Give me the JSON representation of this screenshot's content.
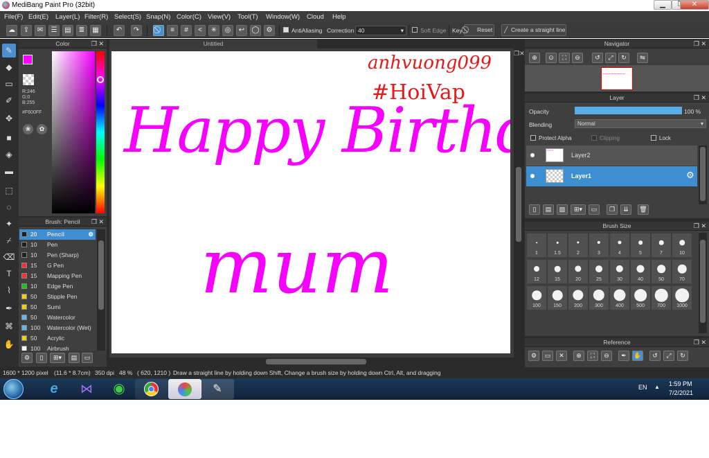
{
  "window": {
    "title": "MediBang Paint Pro (32bit)",
    "min": "▁",
    "max": "❐",
    "close": "✕"
  },
  "menu": [
    "File(F)",
    "Edit(E)",
    "Layer(L)",
    "Filter(R)",
    "Select(S)",
    "Snap(N)",
    "Color(C)",
    "View(V)",
    "Tool(T)",
    "Window(W)",
    "Cloud",
    "Help"
  ],
  "toolbar": {
    "antialiasing": "AntiAliasing",
    "correction_label": "Correction",
    "correction_value": "40",
    "soft_edge": "Soft Edge",
    "key": "Key",
    "reset": "Reset",
    "straight_line": "Create a straight line"
  },
  "color_panel": {
    "title": "Color",
    "r": "R:246",
    "g": "G:0",
    "b": "B:255",
    "hex": "#F600FF",
    "current": "#F600FF"
  },
  "brush_panel": {
    "title": "Brush: Pencil",
    "items": [
      {
        "size": "20",
        "name": "Pencil",
        "color": "#1e1e1e",
        "selected": true
      },
      {
        "size": "10",
        "name": "Pen",
        "color": "#1e1e1e"
      },
      {
        "size": "10",
        "name": "Pen (Sharp)",
        "color": "#1e1e1e"
      },
      {
        "size": "15",
        "name": "G Pen",
        "color": "#ff3030"
      },
      {
        "size": "15",
        "name": "Mapping Pen",
        "color": "#ff3030"
      },
      {
        "size": "10",
        "name": "Edge Pen",
        "color": "#20c020"
      },
      {
        "size": "50",
        "name": "Stipple Pen",
        "color": "#f0d010"
      },
      {
        "size": "50",
        "name": "Sumi",
        "color": "#f0d010"
      },
      {
        "size": "50",
        "name": "Watercolor",
        "color": "#60b8f0"
      },
      {
        "size": "100",
        "name": "Watercolor (Wet)",
        "color": "#60b8f0"
      },
      {
        "size": "50",
        "name": "Acrylic",
        "color": "#f0d010"
      },
      {
        "size": "100",
        "name": "Airbrush",
        "color": "#ffffff"
      }
    ]
  },
  "canvas": {
    "tab": "Untitled",
    "watermark": "anhvuong099",
    "hashtag": "#HoiVap",
    "line1": "Happy Birthday",
    "line2": "mum",
    "ink": "#F600FF",
    "note_ink": "#e81818"
  },
  "navigator": {
    "title": "Navigator"
  },
  "layer_panel": {
    "title": "Layer",
    "opacity_label": "Opacity",
    "opacity_value": "100 %",
    "opacity_fraction": 1.0,
    "blending_label": "Blending",
    "blending_value": "Normal",
    "protect_alpha": "Protect Alpha",
    "clipping": "Clipping",
    "lock": "Lock",
    "layers": [
      {
        "name": "Layer2",
        "selected": false
      },
      {
        "name": "Layer1",
        "selected": true
      }
    ]
  },
  "brush_size_panel": {
    "title": "Brush Size",
    "sizes": [
      "1",
      "1.5",
      "2",
      "3",
      "4",
      "5",
      "7",
      "10",
      "12",
      "15",
      "20",
      "25",
      "30",
      "40",
      "50",
      "70",
      "100",
      "150",
      "200",
      "300",
      "400",
      "500",
      "700",
      "1000"
    ]
  },
  "reference_panel": {
    "title": "Reference"
  },
  "status": {
    "size": "1600 * 1200 pixel",
    "cm": "(11.6 * 8.7cm)",
    "dpi": "350 dpi",
    "zoom": "48 %",
    "coords": "( 620, 1210 )",
    "hint": "Draw a straight line by holding down Shift, Change a brush size by holding down Ctrl, Alt, and dragging"
  },
  "taskbar": {
    "lang": "EN",
    "time": "1:59 PM",
    "date": "7/2/2021"
  }
}
